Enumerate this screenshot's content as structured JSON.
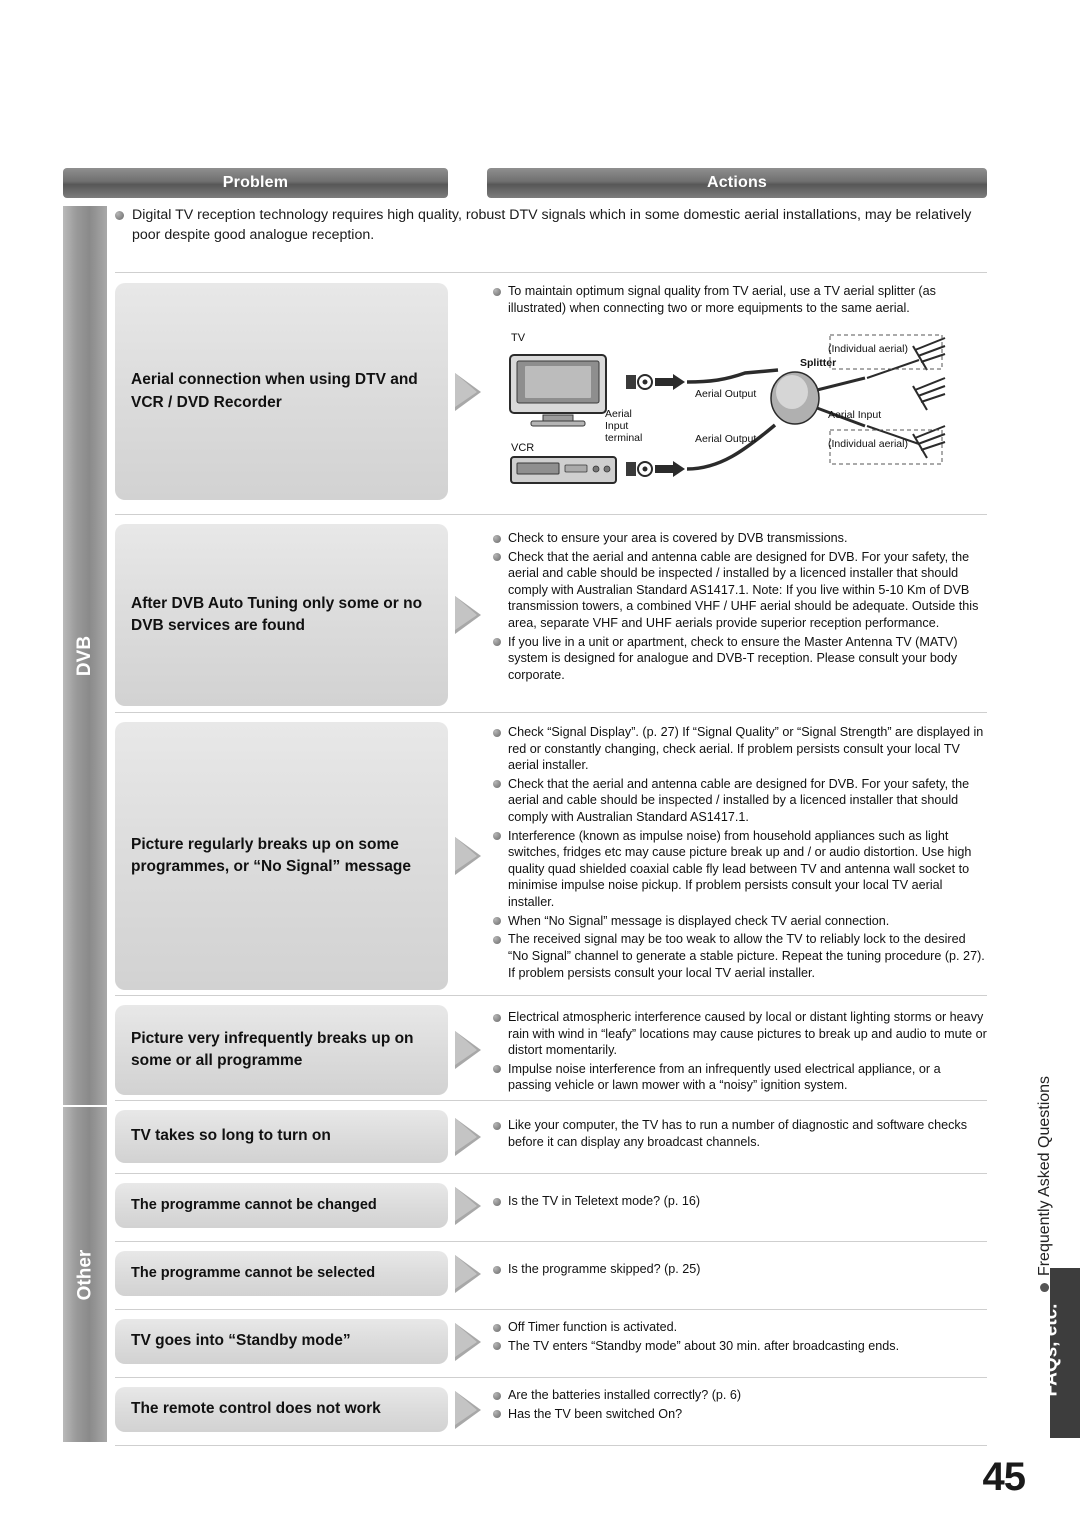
{
  "header": {
    "problem": "Problem",
    "actions": "Actions"
  },
  "spine": {
    "dvb": "DVB",
    "other": "Other"
  },
  "side_tab": {
    "faq_text": "Frequently Asked Questions",
    "faq_bold": "FAQs, etc."
  },
  "page_number": "45",
  "top_note": [
    "Digital TV reception technology requires high quality, robust DTV signals which in some domestic aerial installations, may be relatively poor despite good analogue reception."
  ],
  "rows": [
    {
      "problem": "Aerial connection when using DTV and VCR / DVD Recorder",
      "actions": [
        "To maintain optimum signal quality from TV aerial, use a TV aerial splitter (as illustrated) when connecting two or more equipments to the same aerial."
      ],
      "diagram": {
        "tv": "TV",
        "vcr": "VCR",
        "aerial_input_terminal": "Aerial\nInput\nterminal",
        "aerial_output_1": "Aerial Output",
        "aerial_output_2": "Aerial Output",
        "splitter": "Splitter",
        "aerial_input": "Aerial Input",
        "individual_aerial_1": "(Individual aerial)",
        "individual_aerial_2": "(Individual aerial)"
      }
    },
    {
      "problem": "After DVB Auto Tuning only some or no DVB services are found",
      "actions": [
        "Check to ensure your area is covered by DVB transmissions.",
        "Check that the aerial and antenna cable are designed for DVB. For your safety, the aerial and cable should be inspected / installed by a licenced installer that should comply with Australian Standard AS1417.1. Note: If you live within 5-10 Km of DVB transmission towers, a combined VHF / UHF aerial should be adequate. Outside this area, separate VHF and UHF aerials provide superior reception performance.",
        "If you live in a unit or apartment, check to ensure the Master Antenna TV (MATV) system is designed for analogue and DVB-T reception. Please consult your body corporate."
      ]
    },
    {
      "problem": "Picture regularly breaks up on some programmes, or “No Signal” message",
      "actions": [
        "Check “Signal Display”. (p. 27) If “Signal Quality” or “Signal Strength” are displayed in red or constantly changing, check aerial. If problem persists consult your local TV aerial installer.",
        "Check that the aerial and antenna cable are designed for DVB. For your safety, the aerial and cable should be inspected / installed by a licenced installer that should comply with Australian Standard AS1417.1.",
        "Interference (known as impulse noise) from household appliances such as light switches, fridges etc may cause picture break up and / or audio distortion. Use high quality quad shielded coaxial cable fly lead between TV and antenna wall socket to minimise impulse noise pickup. If problem persists consult your local TV aerial installer.",
        "When “No Signal” message is displayed check TV aerial connection.",
        "The received signal may be too weak to allow the TV to reliably lock to the desired “No Signal” channel to generate a stable picture. Repeat the tuning procedure (p. 27). If problem persists consult your local TV aerial installer."
      ]
    },
    {
      "problem": "Picture very infrequently breaks up on some or all programme",
      "actions": [
        "Electrical atmospheric interference caused by local or distant lighting storms or heavy rain with wind in “leafy” locations may cause pictures to break up and audio to mute or distort momentarily.",
        "Impulse noise interference from an infrequently used electrical appliance, or a passing vehicle or lawn mower with a “noisy” ignition system."
      ]
    },
    {
      "problem": "TV takes so long to turn on",
      "actions": [
        "Like your computer, the TV has to run a number of diagnostic and software checks before it can display any broadcast channels."
      ]
    },
    {
      "problem": "The programme cannot be changed",
      "actions": [
        "Is the TV in Teletext mode? (p. 16)"
      ]
    },
    {
      "problem": "The programme cannot be selected",
      "actions": [
        "Is the programme skipped? (p. 25)"
      ]
    },
    {
      "problem": "TV goes into “Standby mode”",
      "actions": [
        "Off Timer function is activated.",
        "The TV enters “Standby mode” about 30 min. after broadcasting ends."
      ]
    },
    {
      "problem": "The remote control does not work",
      "actions": [
        "Are the batteries installed correctly? (p. 6)",
        "Has the TV been switched On?"
      ]
    }
  ]
}
